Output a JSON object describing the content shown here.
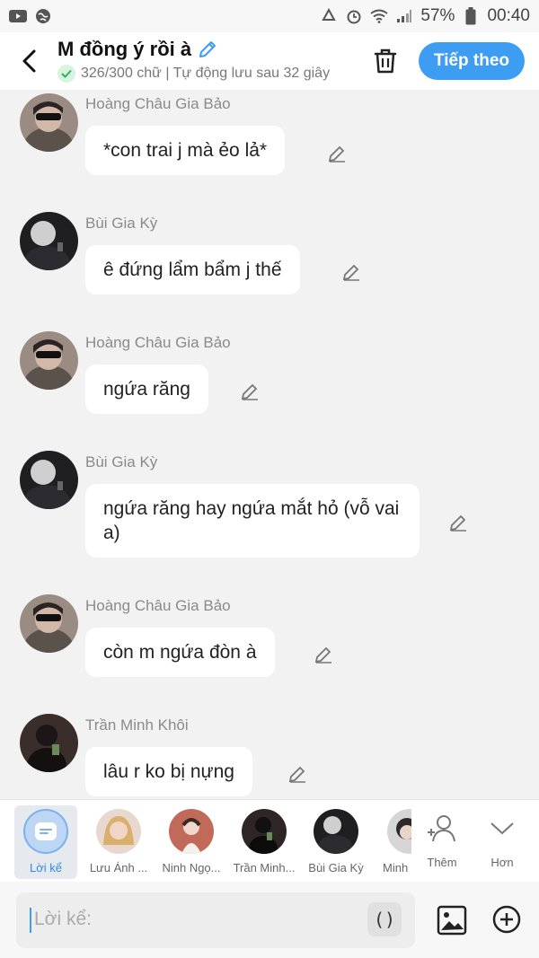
{
  "status_bar": {
    "battery": "57%",
    "time": "00:40"
  },
  "header": {
    "title": "M đồng ý rồi à",
    "subtitle": "326/300 chữ | Tự động lưu sau 32 giây",
    "next_label": "Tiếp theo"
  },
  "messages": [
    {
      "sender": "Hoàng Châu Gia Bảo",
      "text": "*con trai j mà ẻo lả*",
      "avatar": "boy-mask"
    },
    {
      "sender": "Bùi Gia Kỳ",
      "text": "ê đứng lẩm bẩm j thế",
      "avatar": "boy-dark"
    },
    {
      "sender": "Hoàng Châu Gia Bảo",
      "text": "ngứa răng",
      "avatar": "boy-mask"
    },
    {
      "sender": "Bùi Gia Kỳ",
      "text": "ngứa răng hay ngứa mắt hỏ (vỗ vai a)",
      "avatar": "boy-dark"
    },
    {
      "sender": "Hoàng Châu Gia Bảo",
      "text": "còn m ngứa đòn à",
      "avatar": "boy-mask"
    },
    {
      "sender": "Trần Minh Khôi",
      "text": "lâu r ko bị nựng",
      "avatar": "boy-phone"
    }
  ],
  "characters": [
    {
      "name": "Lời kể"
    },
    {
      "name": "Lưu Ánh ..."
    },
    {
      "name": "Ninh Ngọ..."
    },
    {
      "name": "Trần Minh..."
    },
    {
      "name": "Bùi Gia Kỳ"
    },
    {
      "name": "Minh"
    },
    {
      "name": "Thêm"
    },
    {
      "name": "Hơn"
    }
  ],
  "input": {
    "placeholder": "Lời kể:",
    "paren_label": "()"
  }
}
